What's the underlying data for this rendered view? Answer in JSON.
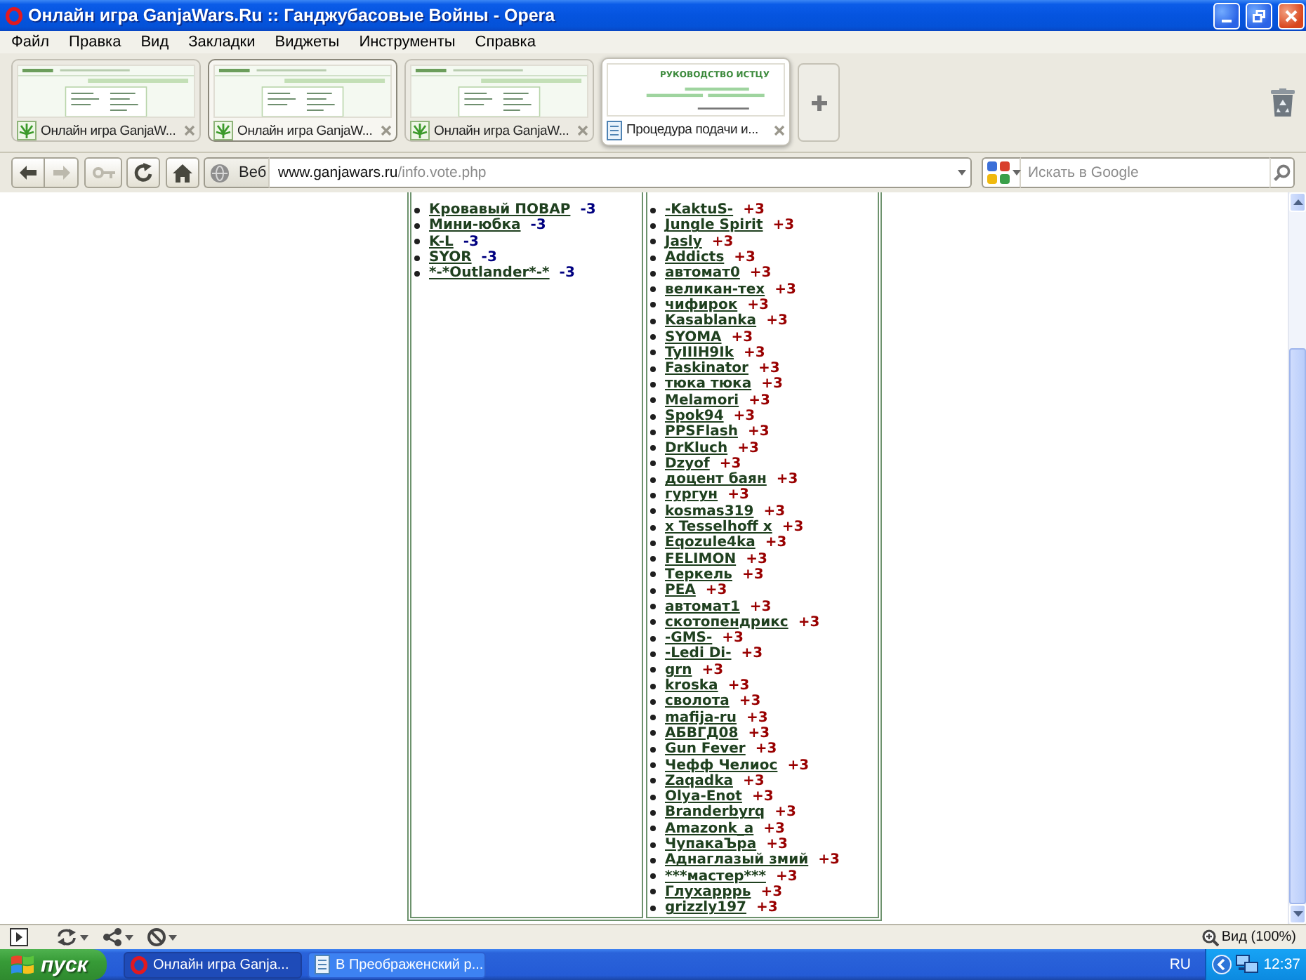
{
  "window": {
    "title": "Онлайн игра GanjaWars.Ru :: Ганджубасовые Войны - Opera"
  },
  "menu": [
    "Файл",
    "Правка",
    "Вид",
    "Закладки",
    "Виджеты",
    "Инструменты",
    "Справка"
  ],
  "tabs": [
    {
      "kind": "game",
      "title": "Онлайн игра GanjaW...",
      "selected": false,
      "hovered": false
    },
    {
      "kind": "game",
      "title": "Онлайн игра GanjaW...",
      "selected": true,
      "hovered": false
    },
    {
      "kind": "game",
      "title": "Онлайн игра GanjaW...",
      "selected": false,
      "hovered": false
    },
    {
      "kind": "document",
      "title": "Процедура подачи и...",
      "selected": false,
      "hovered": true,
      "thumbnail_heading": "РУКОВОДСТВО ИСТЦУ"
    }
  ],
  "nav_buttons": [
    {
      "kind": "back",
      "disabled": false
    },
    {
      "kind": "forward",
      "disabled": true
    },
    {
      "kind": "key",
      "disabled": true
    },
    {
      "kind": "reload",
      "disabled": false
    },
    {
      "kind": "home",
      "disabled": false
    }
  ],
  "address_bar": {
    "mode": "Веб",
    "host": "www.ganjawars.ru",
    "path": "/info.vote.php"
  },
  "search": {
    "placeholder": "Искать в Google"
  },
  "vote_table": {
    "columns": [
      {
        "kind": "against",
        "rows": [
          {
            "name": "Кровавый ПОВАР",
            "score": "-3"
          },
          {
            "name": "Мини-юбка",
            "score": "-3"
          },
          {
            "name": "K-L",
            "score": "-3"
          },
          {
            "name": "SYOR",
            "score": "-3"
          },
          {
            "name": "*-*Outlander*-*",
            "score": "-3"
          }
        ]
      },
      {
        "kind": "for",
        "rows": [
          {
            "name": "-KaktuS-",
            "score": "+3"
          },
          {
            "name": "Jungle Spirit",
            "score": "+3"
          },
          {
            "name": "Jasly",
            "score": "+3"
          },
          {
            "name": "Addicts",
            "score": "+3"
          },
          {
            "name": "автомат0",
            "score": "+3"
          },
          {
            "name": "великан-тех",
            "score": "+3"
          },
          {
            "name": "чифирок",
            "score": "+3"
          },
          {
            "name": "Kasablanka",
            "score": "+3"
          },
          {
            "name": "SYOMA",
            "score": "+3"
          },
          {
            "name": "TyIIIH9Ik",
            "score": "+3"
          },
          {
            "name": "Faskinator",
            "score": "+3"
          },
          {
            "name": "тюка тюка",
            "score": "+3"
          },
          {
            "name": "Melamori",
            "score": "+3"
          },
          {
            "name": "Spok94",
            "score": "+3"
          },
          {
            "name": "PPSFlash",
            "score": "+3"
          },
          {
            "name": "DrKluch",
            "score": "+3"
          },
          {
            "name": "Dzyof",
            "score": "+3"
          },
          {
            "name": "доцент баян",
            "score": "+3"
          },
          {
            "name": "гургун",
            "score": "+3"
          },
          {
            "name": "kosmas319",
            "score": "+3"
          },
          {
            "name": "x Tesselhoff x",
            "score": "+3"
          },
          {
            "name": "Eqozule4ka",
            "score": "+3"
          },
          {
            "name": "FELIMON",
            "score": "+3"
          },
          {
            "name": "Теркель",
            "score": "+3"
          },
          {
            "name": "PEA",
            "score": "+3"
          },
          {
            "name": "автомат1",
            "score": "+3"
          },
          {
            "name": "скотопендрикс",
            "score": "+3"
          },
          {
            "name": "-GMS-",
            "score": "+3"
          },
          {
            "name": "-Ledi Di-",
            "score": "+3"
          },
          {
            "name": "grn",
            "score": "+3"
          },
          {
            "name": "kroska",
            "score": "+3"
          },
          {
            "name": "сволота",
            "score": "+3"
          },
          {
            "name": "mafija-ru",
            "score": "+3"
          },
          {
            "name": "АБВГД08",
            "score": "+3"
          },
          {
            "name": "Gun Fever",
            "score": "+3"
          },
          {
            "name": "Чефф Челиос",
            "score": "+3"
          },
          {
            "name": "Zaqadka",
            "score": "+3"
          },
          {
            "name": "Olya-Enot",
            "score": "+3"
          },
          {
            "name": "Branderbyrq",
            "score": "+3"
          },
          {
            "name": "Amazonk_a",
            "score": "+3"
          },
          {
            "name": "ЧупакаЪра",
            "score": "+3"
          },
          {
            "name": "Аднаглазый змий",
            "score": "+3"
          },
          {
            "name": "***мастер***",
            "score": "+3"
          },
          {
            "name": "Глухарррь",
            "score": "+3"
          },
          {
            "name": "grizzly197",
            "score": "+3"
          }
        ]
      }
    ]
  },
  "status_bar": {
    "zoom": "Вид (100%)"
  },
  "taskbar": {
    "start": "пуск",
    "tasks": [
      {
        "kind": "browser",
        "title": "Онлайн игра Ganja...",
        "selected": true
      },
      {
        "kind": "document",
        "title": "В Преображенский р...",
        "selected": false
      }
    ],
    "language": "RU",
    "clock": "12:37"
  }
}
